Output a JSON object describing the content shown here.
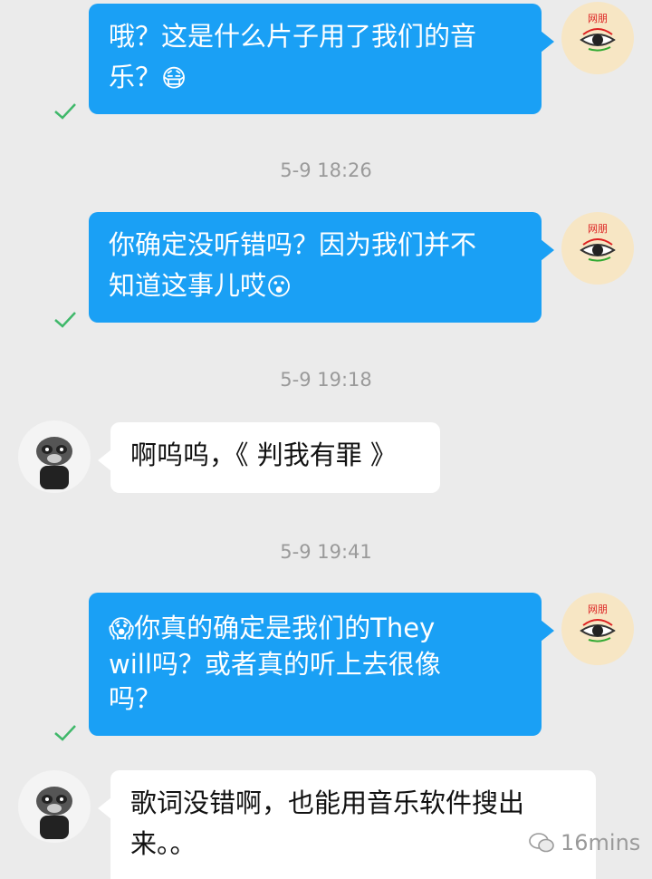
{
  "messages": [
    {
      "line1": "哦？这是什么片子用了我们的音",
      "line2": "乐？",
      "emoji": "😷"
    },
    {
      "line1": "你确定没听错吗？因为我们并不",
      "line2": "知道这事儿哎",
      "emoji": "😮"
    },
    {
      "text": "啊呜呜，《 判我有罪 》"
    },
    {
      "emoji": "😱",
      "line1": "你真的确定是我们的They",
      "line2": "will吗？或者真的听上去很像",
      "line3": "吗？"
    },
    {
      "line1": "歌词没错啊，也能用音乐软件搜出",
      "line2": "来。。"
    }
  ],
  "timestamps": [
    "5-9 18:26",
    "5-9 19:18",
    "5-9 19:41"
  ],
  "avatar_me_label": "网朋",
  "watermark": "16mins",
  "colors": {
    "outgoing": "#1aa0f5",
    "incoming": "#ffffff",
    "check": "#3fb86a"
  },
  "icons": {
    "read": "checkmark-icon",
    "watermark": "wechat-icon"
  }
}
